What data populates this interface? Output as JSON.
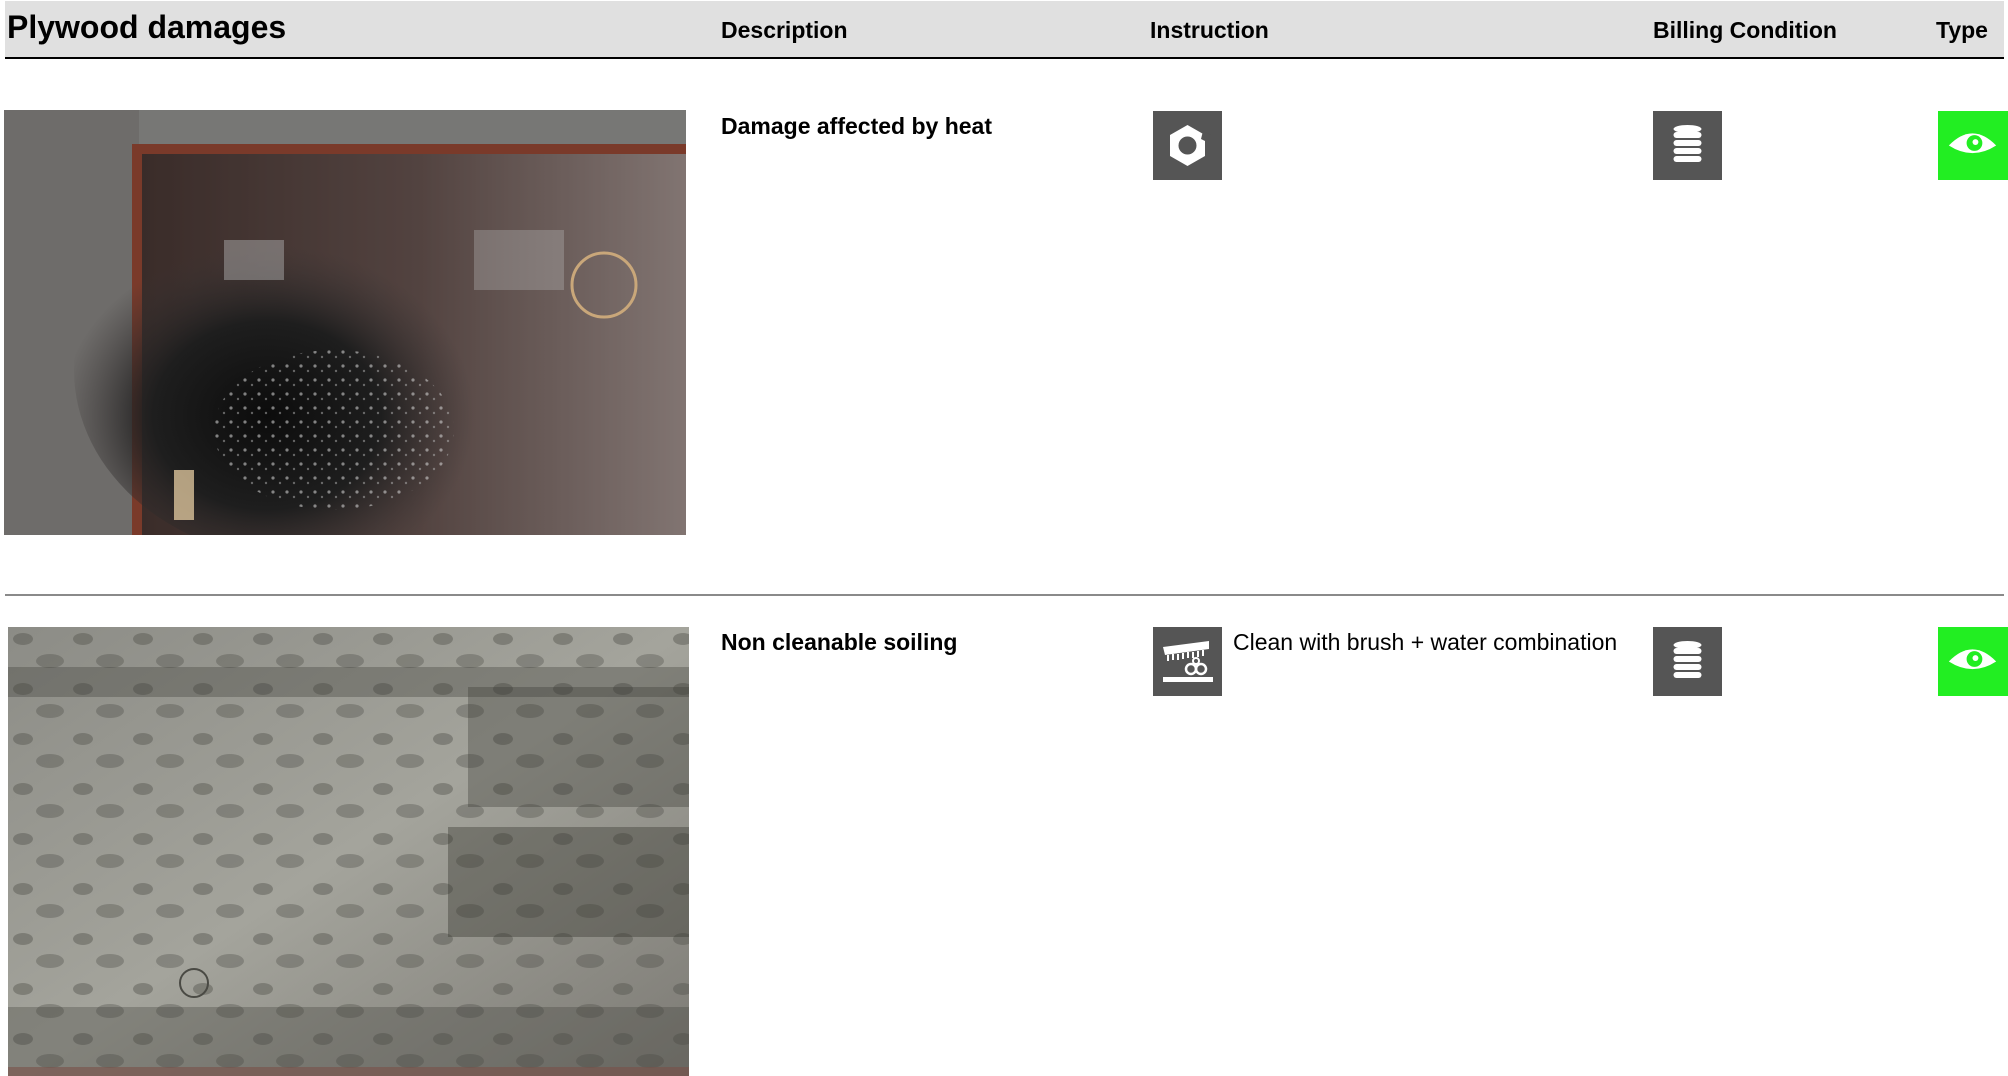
{
  "header": {
    "title": "Plywood damages",
    "columns": {
      "description": "Description",
      "instruction": "Instruction",
      "billing": "Billing Condition",
      "type": "Type"
    }
  },
  "rows": [
    {
      "photo": "heat-damaged plywood panel",
      "description": "Damage affected by heat",
      "instruction_icon": "hex-nut-icon",
      "instruction_text": "",
      "billing_icon": "coin-stack-icon",
      "type_icon": "eye-icon"
    },
    {
      "photo": "soiled plywood panel",
      "description": "Non cleanable soiling",
      "instruction_icon": "brush-water-icon",
      "instruction_text": "Clean with brush + water combination",
      "billing_icon": "coin-stack-icon",
      "type_icon": "eye-icon"
    }
  ],
  "colors": {
    "header_bg": "#e0e0e0",
    "icon_bg": "#555555",
    "type_bg": "#22ee22"
  }
}
